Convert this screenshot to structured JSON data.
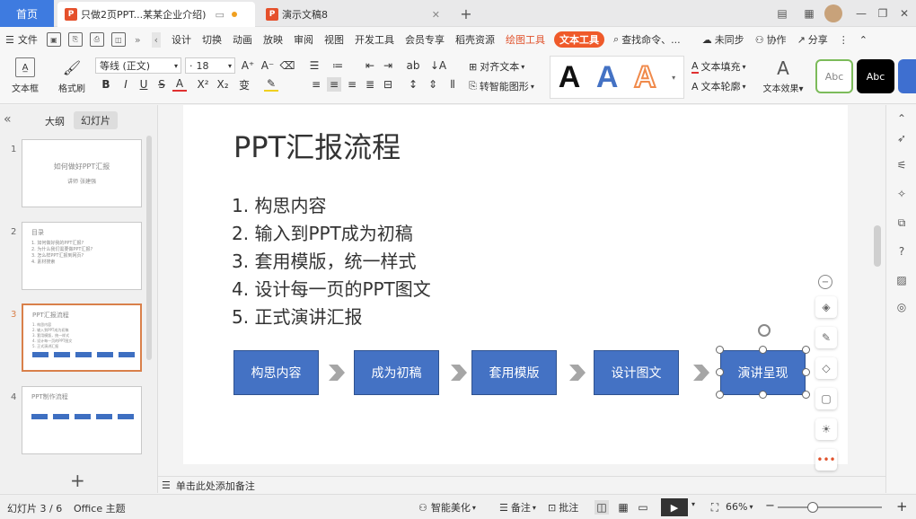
{
  "tabs": {
    "home": "首页",
    "doc1": "只做2页PPT...某某企业介绍)",
    "doc2": "演示文稿8"
  },
  "menu": {
    "file": "文件",
    "items": [
      "设计",
      "切换",
      "动画",
      "放映",
      "审阅",
      "视图",
      "开发工具",
      "会员专享",
      "稻壳资源"
    ],
    "draw_tool": "绘图工具",
    "text_tool": "文本工具",
    "search": "查找命令、...",
    "sync": "未同步",
    "collab": "协作",
    "share": "分享"
  },
  "ribbon": {
    "textbox": "文本框",
    "format_brush": "格式刷",
    "font_name": "等线 (正文)",
    "font_size": "18",
    "align_text": "对齐文本",
    "smart_shape": "转智能图形",
    "text_fill": "文本填充",
    "text_outline": "文本轮廓",
    "text_effect": "文本效果",
    "style_a": "A",
    "abc1": "Abc",
    "abc2": "Abc",
    "colors": {
      "a1": "#111111",
      "a2": "#4472c4",
      "a3": "#f08a4b"
    }
  },
  "panel": {
    "outline": "大纲",
    "slides": "幻灯片",
    "thumbs": [
      {
        "num": "1",
        "title": "如何做好PPT汇报",
        "sub": "讲师  张建强"
      },
      {
        "num": "2",
        "title": "目录",
        "lines": [
          "1. 如何做好我的PPT汇报?",
          "2. 为什么我们需要做PPT汇报?",
          "3. 怎么样PPT汇报到网页?",
          "4. 素材搜索"
        ]
      },
      {
        "num": "3",
        "title": "PPT汇报流程",
        "lines": [
          "1. 构思内容",
          "2. 输入到PPT成为初稿",
          "3. 套用模版，统一样式",
          "4. 设计每一页的PPT图文",
          "5. 正式演讲汇报"
        ]
      },
      {
        "num": "4",
        "title": "PPT制作流程"
      }
    ]
  },
  "slide": {
    "title": "PPT汇报流程",
    "list": [
      "1.   构思内容",
      "2.   输入到PPT成为初稿",
      "3.   套用模版，统一样式",
      "4.   设计每一页的PPT图文",
      "5.   正式演讲汇报"
    ],
    "flow": [
      "构思内容",
      "成为初稿",
      "套用模版",
      "设计图文",
      "演讲呈现"
    ]
  },
  "notes": "单击此处添加备注",
  "status": {
    "slide_count": "幻灯片 3 / 6",
    "theme": "Office 主题",
    "beautify": "智能美化",
    "notes": "备注",
    "comment": "批注",
    "zoom": "66%"
  }
}
